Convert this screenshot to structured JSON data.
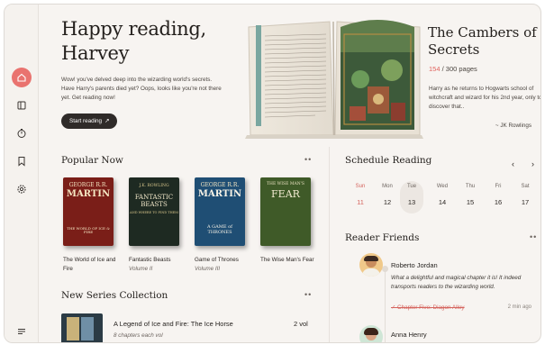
{
  "greeting": {
    "line1": "Happy reading,",
    "line2": "Harvey"
  },
  "intro": "Wow! you've delved deep into the wizarding world's secrets. Have Harry's parents died yet? Oops, looks like you're not there yet. Get reading now!",
  "start_button": "Start reading",
  "start_arrow": "↗",
  "featured": {
    "title_line1": "The Cambers of",
    "title_line2": "Secrets",
    "current_page": "154",
    "total_pages": "/ 300 pages",
    "description": "Harry as he returns to Hogwarts school of witchcraft and wizard for his 2nd year, only to discover that..",
    "author": "~ JK Rowlings"
  },
  "popular": {
    "title": "Popular Now",
    "more": "••",
    "books": [
      {
        "title": "The World of Ice and Fire",
        "subtitle": "",
        "cover_top": "GEORGE R.R.",
        "cover_mid": "MARTIN",
        "cover_bottom": "THE WORLD OF ICE & FIRE"
      },
      {
        "title": "Fantastic Beasts",
        "subtitle": "Volume II",
        "cover_top": "J.K. ROWLING",
        "cover_mid": "FANTASTIC BEASTS",
        "cover_bottom": "AND WHERE TO FIND THEM"
      },
      {
        "title": "Game of Thrones",
        "subtitle": "Volume III",
        "cover_top": "GEORGE R.R.",
        "cover_mid": "MARTIN",
        "cover_bottom": "A GAME of THRONES"
      },
      {
        "title": "The Wise Man's Fear",
        "subtitle": "",
        "cover_top": "THE WISE MAN'S",
        "cover_mid": "FEAR",
        "cover_bottom": ""
      }
    ]
  },
  "series": {
    "title": "New Series Collection",
    "more": "••",
    "item_title": "A Legend of Ice and Fire: The Ice Horse",
    "item_sub": "8 chapters each vol",
    "item_vol": "2 vol"
  },
  "schedule": {
    "title": "Schedule Reading",
    "prev": "‹",
    "next": "›",
    "days": [
      {
        "name": "Sun",
        "date": "11"
      },
      {
        "name": "Mon",
        "date": "12"
      },
      {
        "name": "Tue",
        "date": "13"
      },
      {
        "name": "Wed",
        "date": "14"
      },
      {
        "name": "Thu",
        "date": "15"
      },
      {
        "name": "Fri",
        "date": "16"
      },
      {
        "name": "Sat",
        "date": "17"
      }
    ]
  },
  "friends": {
    "title": "Reader Friends",
    "more": "••",
    "list": [
      {
        "name": "Roberto Jordan",
        "quote": "What a delightful and magical chapter it is! It indeed transports readers to the wizarding world.",
        "chapter": "✓ Chapter Five: Diagon Alley",
        "time": "2 min ago"
      },
      {
        "name": "Anna Henry"
      }
    ]
  },
  "colors": {
    "accent": "#e9736f",
    "dark": "#2f2b29",
    "sunday": "#d5635d"
  },
  "icons": [
    "home-icon",
    "book-icon",
    "timer-icon",
    "bookmark-icon",
    "settings-icon",
    "menu-icon"
  ]
}
